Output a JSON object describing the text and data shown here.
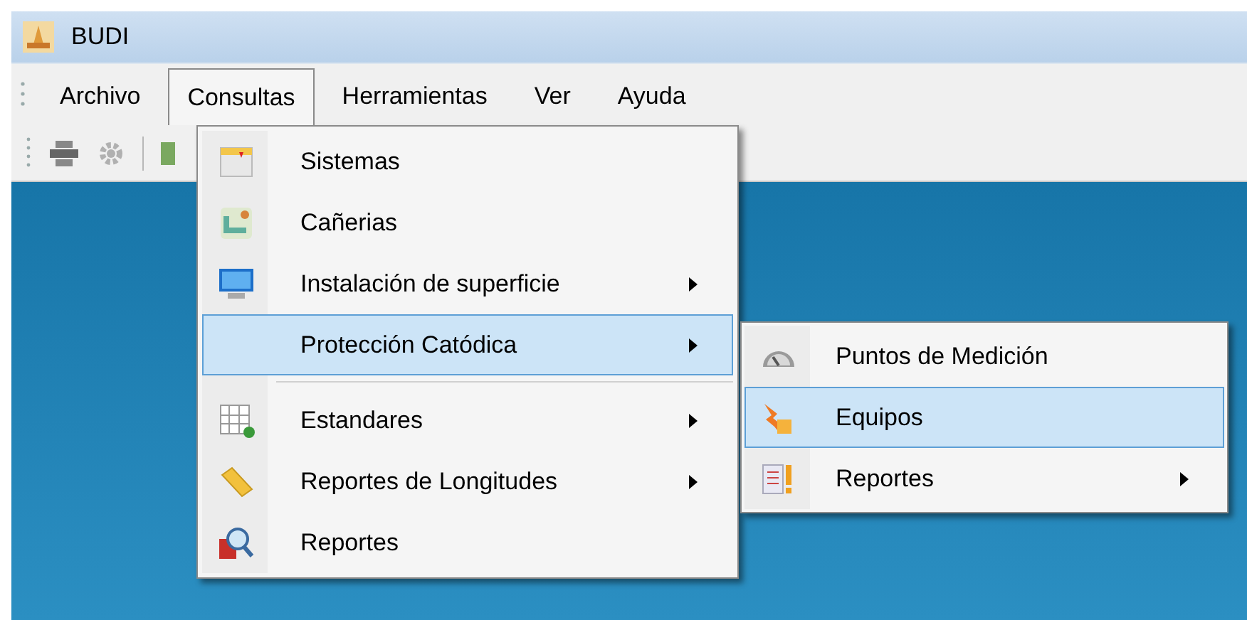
{
  "window": {
    "title": "BUDI"
  },
  "menu_bar": [
    {
      "label": "Archivo",
      "selected": false
    },
    {
      "label": "Consultas",
      "selected": true
    },
    {
      "label": "Herramientas",
      "selected": false
    },
    {
      "label": "Ver",
      "selected": false
    },
    {
      "label": "Ayuda",
      "selected": false
    }
  ],
  "consultas_menu": [
    {
      "kind": "item",
      "label": "Sistemas",
      "submenu": false,
      "selected": false
    },
    {
      "kind": "item",
      "label": "Cañerias",
      "submenu": false,
      "selected": false
    },
    {
      "kind": "item",
      "label": "Instalación de superficie",
      "submenu": true,
      "selected": false
    },
    {
      "kind": "item",
      "label": "Protección Catódica",
      "submenu": true,
      "selected": true
    },
    {
      "kind": "separator"
    },
    {
      "kind": "item",
      "label": "Estandares",
      "submenu": true,
      "selected": false
    },
    {
      "kind": "item",
      "label": "Reportes de Longitudes",
      "submenu": true,
      "selected": false
    },
    {
      "kind": "item",
      "label": "Reportes",
      "submenu": false,
      "selected": false
    }
  ],
  "proteccion_submenu": [
    {
      "kind": "item",
      "label": "Puntos de Medición",
      "submenu": false,
      "selected": false
    },
    {
      "kind": "item",
      "label": "Equipos",
      "submenu": false,
      "selected": true
    },
    {
      "kind": "item",
      "label": "Reportes",
      "submenu": true,
      "selected": false
    }
  ]
}
